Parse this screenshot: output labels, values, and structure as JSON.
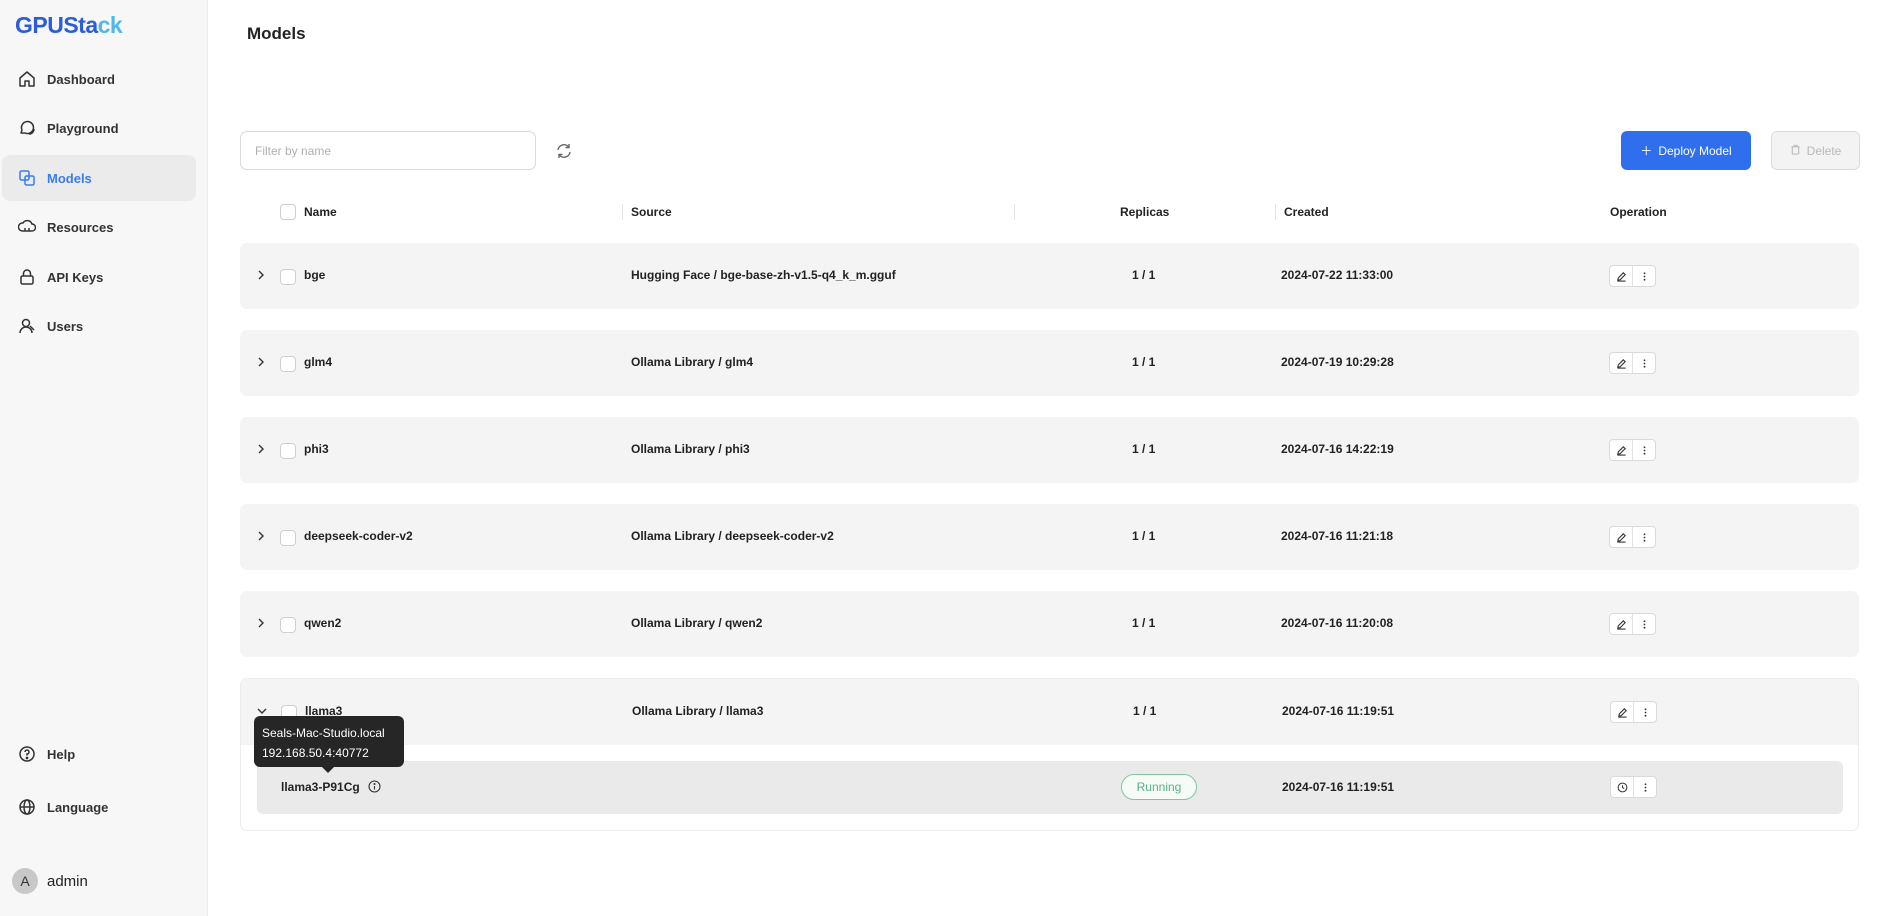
{
  "app": {
    "logo_main": "GPUSta",
    "logo_accent": "ck"
  },
  "sidebar": {
    "items": [
      {
        "label": "Dashboard",
        "icon": "home-icon"
      },
      {
        "label": "Playground",
        "icon": "chat-icon"
      },
      {
        "label": "Models",
        "icon": "models-icon",
        "active": true
      },
      {
        "label": "Resources",
        "icon": "resources-icon"
      },
      {
        "label": "API Keys",
        "icon": "lock-icon"
      },
      {
        "label": "Users",
        "icon": "users-icon"
      }
    ],
    "bottom_items": [
      {
        "label": "Help",
        "icon": "help-icon"
      },
      {
        "label": "Language",
        "icon": "globe-icon"
      }
    ],
    "user": {
      "avatar_letter": "A",
      "name": "admin"
    }
  },
  "page": {
    "title": "Models"
  },
  "toolbar": {
    "search_placeholder": "Filter by name",
    "deploy_label": "Deploy Model",
    "delete_label": "Delete"
  },
  "table": {
    "headers": {
      "name": "Name",
      "source": "Source",
      "replicas": "Replicas",
      "created": "Created",
      "operation": "Operation"
    },
    "rows": [
      {
        "name": "bge",
        "source": "Hugging Face / bge-base-zh-v1.5-q4_k_m.gguf",
        "replicas": "1 / 1",
        "created": "2024-07-22 11:33:00"
      },
      {
        "name": "glm4",
        "source": "Ollama Library / glm4",
        "replicas": "1 / 1",
        "created": "2024-07-19 10:29:28"
      },
      {
        "name": "phi3",
        "source": "Ollama Library / phi3",
        "replicas": "1 / 1",
        "created": "2024-07-16 14:22:19"
      },
      {
        "name": "deepseek-coder-v2",
        "source": "Ollama Library / deepseek-coder-v2",
        "replicas": "1 / 1",
        "created": "2024-07-16 11:21:18"
      },
      {
        "name": "qwen2",
        "source": "Ollama Library / qwen2",
        "replicas": "1 / 1",
        "created": "2024-07-16 11:20:08"
      }
    ],
    "expanded_row": {
      "name": "llama3",
      "source": "Ollama Library / llama3",
      "replicas": "1 / 1",
      "created": "2024-07-16 11:19:51",
      "instance": {
        "name": "llama3-P91Cg",
        "status": "Running",
        "created": "2024-07-16 11:19:51"
      }
    }
  },
  "tooltip": {
    "line1": "Seals-Mac-Studio.local",
    "line2": "192.168.50.4:40772"
  },
  "colors": {
    "accent": "#2f6fed",
    "running": "#58b184",
    "active_nav_text": "#3a7bf0"
  }
}
